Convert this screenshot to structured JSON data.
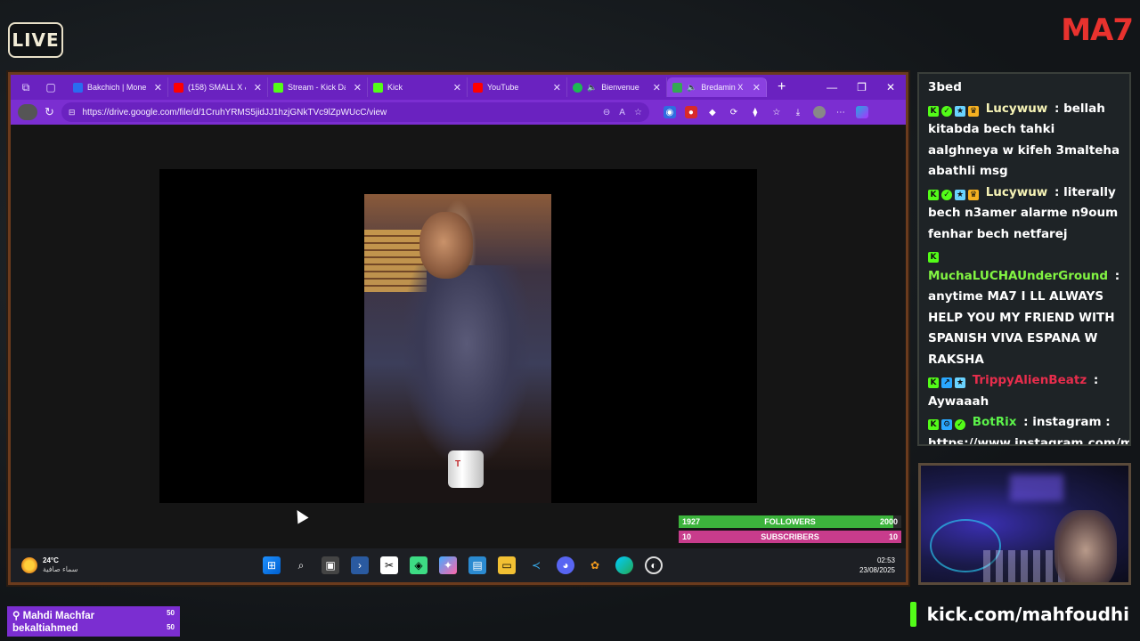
{
  "overlay": {
    "live_label": "LIVE",
    "brand_logo": "MA7",
    "kick_url": "kick.com/mahfoudhi",
    "accent_kick": "#53fc18",
    "accent_purple": "#7b2ed1"
  },
  "browser": {
    "tabs": [
      {
        "label": "Bakchich | Mone",
        "fav": "#2a6cf0",
        "active": false
      },
      {
        "label": "(158) SMALL X &",
        "fav": "#ff0000",
        "active": false
      },
      {
        "label": "Stream - Kick Da",
        "fav": "#53fc18",
        "active": false
      },
      {
        "label": "Kick",
        "fav": "#53fc18",
        "active": false
      },
      {
        "label": "YouTube",
        "fav": "#ff0000",
        "active": false
      },
      {
        "label": "Bienvenue",
        "fav": "#1db954",
        "active": false
      },
      {
        "label": "Bredamin X",
        "fav": "#34a853",
        "active": true
      }
    ],
    "url": "https://drive.google.com/file/d/1CruhYRMS5jidJJ1hzjGNkTVc9lZpWUcC/view"
  },
  "taskbar": {
    "temperature": "24°C",
    "weather_desc": "سماء صافية",
    "time": "02:53",
    "date": "23/08/2025",
    "icons": [
      "windows-start-icon",
      "search-icon",
      "task-view-icon",
      "terminal-icon",
      "capcut-icon",
      "android-icon",
      "copilot-icon",
      "folder-icon",
      "file-explorer-icon",
      "vscode-icon",
      "discord-icon",
      "fl-studio-icon",
      "edge-icon",
      "obs-icon"
    ]
  },
  "stats": {
    "followers_current": "1927",
    "followers_label": "FOLLOWERS",
    "followers_goal": "2000",
    "followers_progress": 0.9635,
    "subs_current": "10",
    "subs_label": "SUBSCRIBERS",
    "subs_goal": "10",
    "subs_progress": 1.0
  },
  "chat": {
    "top_fragment": "3bed",
    "messages": [
      {
        "user": "Lucywuw",
        "text": "bellah kitabda bech tahki aalghneya w kifeh 3malteha abathli msg"
      },
      {
        "user": "Lucywuw",
        "text": "literally bech n3amer alarme n9oum fenhar bech netfarej"
      },
      {
        "user": "MuchaLUCHAUnderGround",
        "text": "anytime MA7 I LL ALWAYS HELP YOU MY FRIEND WITH SPANISH VIVA ESPANA W RAKSHA"
      },
      {
        "user": "TrippyAlienBeatz",
        "text": "Aywaaah"
      },
      {
        "user": "BotRix",
        "text": "instagram : https://www.instagram.com/mahfoudhi_tn/"
      }
    ]
  },
  "alerts": [
    {
      "name": "Mahdi Machfar",
      "count": "50"
    },
    {
      "name": "bekaltiahmed",
      "count": "50"
    }
  ]
}
